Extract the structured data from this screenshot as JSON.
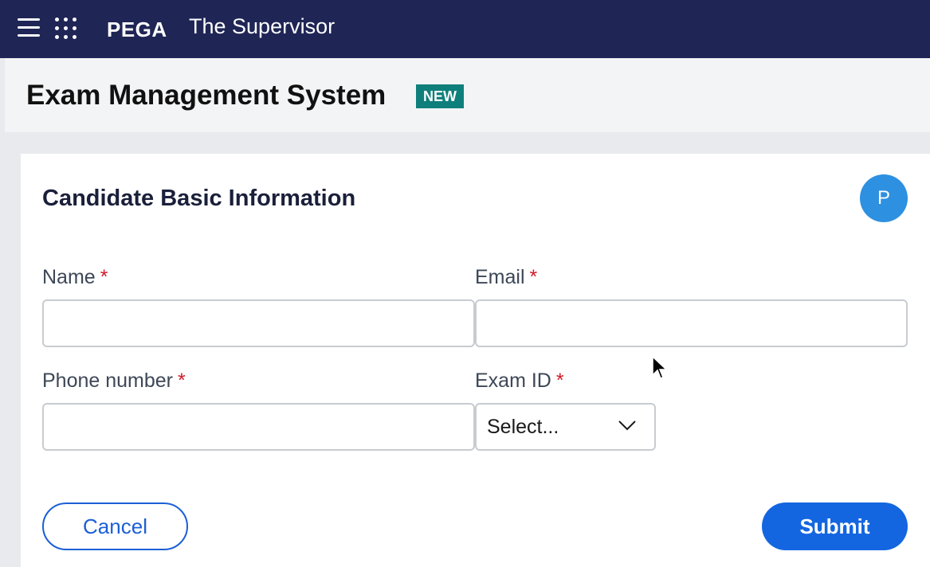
{
  "topbar": {
    "menu_icon": "hamburger-menu-icon",
    "apps_icon": "app-grid-icon",
    "brand": "PEGA",
    "app_name": "The Supervisor"
  },
  "header": {
    "title": "Exam Management System",
    "badge": "NEW"
  },
  "form": {
    "title": "Candidate Basic Information",
    "avatar_initial": "P",
    "fields": {
      "name": {
        "label": "Name",
        "required_marker": "*",
        "value": "",
        "placeholder": ""
      },
      "email": {
        "label": "Email",
        "required_marker": "*",
        "value": "",
        "placeholder": ""
      },
      "phone": {
        "label": "Phone number",
        "required_marker": "*",
        "value": "",
        "placeholder": ""
      },
      "exam_id": {
        "label": "Exam ID",
        "required_marker": "*",
        "selected": "Select..."
      }
    },
    "actions": {
      "cancel_label": "Cancel",
      "submit_label": "Submit"
    }
  },
  "colors": {
    "topbar": "#1f2555",
    "badge": "#0e7f7b",
    "avatar": "#2e90e0",
    "primary": "#1366e0",
    "required": "#d11a2a"
  }
}
